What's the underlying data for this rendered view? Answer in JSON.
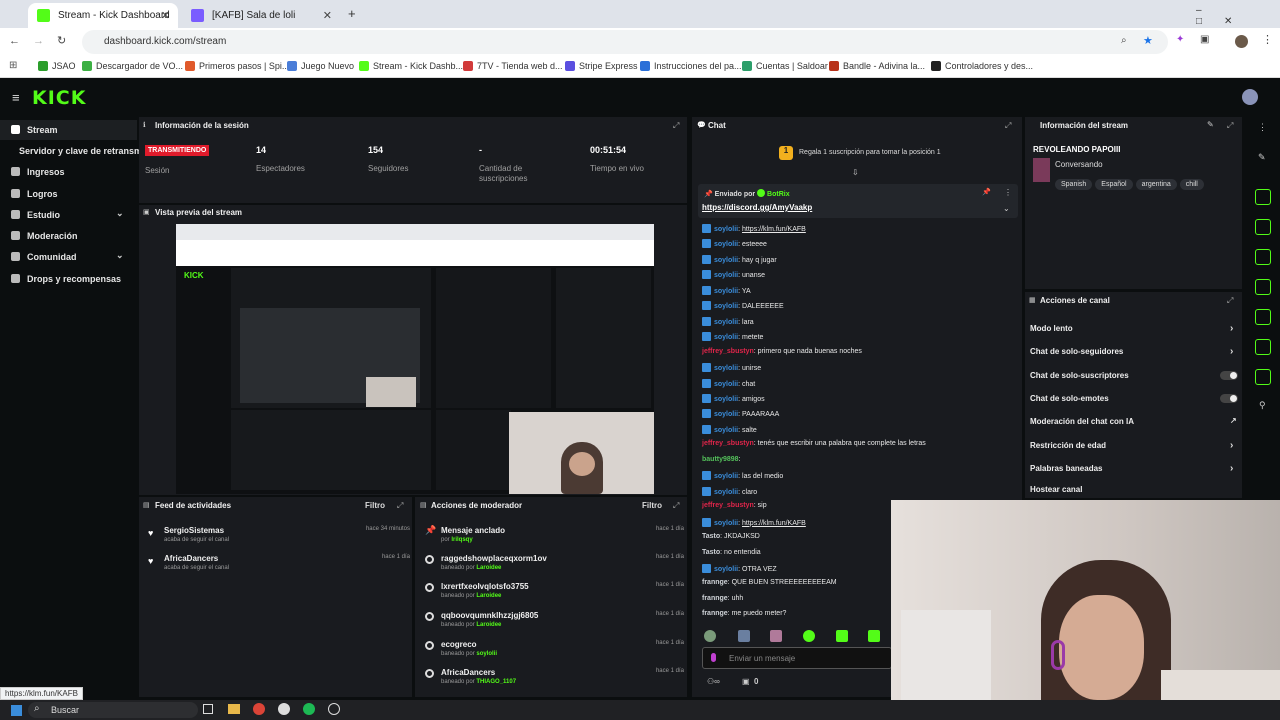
{
  "browser": {
    "tabs": [
      {
        "label": "Stream - Kick Dashboard",
        "active": true
      },
      {
        "label": "[KAFB] Sala de loli",
        "active": false
      }
    ],
    "address": "dashboard.kick.com/stream",
    "bookmarks": [
      "JSAO",
      "Descargador de VO...",
      "Primeros pasos | Spi...",
      "Juego Nuevo",
      "Stream - Kick Dashb...",
      "7TV - Tienda web d...",
      "Stripe Express",
      "Instrucciones del pa...",
      "Cuentas | Saldoar",
      "Bandle - Adivina la...",
      "Controladores y des..."
    ]
  },
  "sidebar": {
    "items": [
      {
        "label": "Stream"
      },
      {
        "label": "Servidor y clave de retransmisión"
      },
      {
        "label": "Ingresos"
      },
      {
        "label": "Logros"
      },
      {
        "label": "Estudio"
      },
      {
        "label": "Moderación"
      },
      {
        "label": "Comunidad"
      },
      {
        "label": "Drops y recompensas"
      }
    ]
  },
  "session": {
    "title": "Información de la sesión",
    "badge": "TRANSMITIENDO",
    "label": "Sesión",
    "stats": [
      {
        "value": "14",
        "label": "Espectadores"
      },
      {
        "value": "154",
        "label": "Seguidores"
      },
      {
        "value": "-",
        "label": "Cantidad de suscripciones"
      },
      {
        "value": "00:51:54",
        "label": "Tiempo en vivo"
      }
    ]
  },
  "preview": {
    "title": "Vista previa del stream"
  },
  "feed": {
    "title": "Feed de actividades",
    "filter": "Filtro",
    "items": [
      {
        "name": "SergioSistemas",
        "sub": "acaba de seguir el canal",
        "time": "hace 34 minutos"
      },
      {
        "name": "AfricaDancers",
        "sub": "acaba de seguir el canal",
        "time": "hace 1 día"
      }
    ]
  },
  "mod": {
    "title": "Acciones de moderador",
    "filter": "Filtro",
    "items": [
      {
        "name": "Mensaje anclado",
        "pre": "por",
        "by": "lrilqsqy",
        "time": "hace 1 día"
      },
      {
        "name": "raggedshowplaceqxorm1ov",
        "pre": "baneado por",
        "by": "Laroidee",
        "time": "hace 1 día"
      },
      {
        "name": "lxrertfxeolvqlotsfo3755",
        "pre": "baneado por",
        "by": "Laroidee",
        "time": "hace 1 día"
      },
      {
        "name": "qqboovqumnklhzzjgj6805",
        "pre": "baneado por",
        "by": "Laroidee",
        "time": "hace 1 día"
      },
      {
        "name": "ecogreco",
        "pre": "baneado por",
        "by": "soylolii",
        "time": "hace 1 día"
      },
      {
        "name": "AfricaDancers",
        "pre": "baneado por",
        "by": "THIAGO_1107",
        "time": "hace 1 día"
      }
    ]
  },
  "chat": {
    "title": "Chat",
    "promo": "Regala 1 suscripción para tomar la posición 1",
    "pinned_header": "Enviado por",
    "pinned_user": "BotRix",
    "pinned_link": "https://discord.gg/AmyVaakp",
    "messages": [
      {
        "user": "soylolii",
        "text": "https://klm.fun/KAFB",
        "link": true,
        "color": "#3a8ddb"
      },
      {
        "user": "soylolii",
        "text": "esteeee",
        "color": "#3a8ddb"
      },
      {
        "user": "soylolii",
        "text": "hay q jugar",
        "color": "#3a8ddb"
      },
      {
        "user": "soylolii",
        "text": "unanse",
        "color": "#3a8ddb"
      },
      {
        "user": "soylolii",
        "text": "YA",
        "color": "#3a8ddb"
      },
      {
        "user": "soylolii",
        "text": "DALEEEEEE",
        "color": "#3a8ddb"
      },
      {
        "user": "soylolii",
        "text": "lara",
        "color": "#3a8ddb"
      },
      {
        "user": "soylolii",
        "text": "metete",
        "color": "#3a8ddb"
      },
      {
        "user": "jeffrey_sbustyn",
        "text": "primero que nada buenas noches",
        "color": "#e0254a",
        "nobadge": true
      },
      {
        "user": "soylolii",
        "text": "unirse",
        "color": "#3a8ddb"
      },
      {
        "user": "soylolii",
        "text": "chat",
        "color": "#3a8ddb"
      },
      {
        "user": "soylolii",
        "text": "amigos",
        "color": "#3a8ddb"
      },
      {
        "user": "soylolii",
        "text": "PAAARAAA",
        "color": "#3a8ddb"
      },
      {
        "user": "soylolii",
        "text": "salte",
        "color": "#3a8ddb"
      },
      {
        "user": "jeffrey_sbustyn",
        "text": "tenés que escribir una palabra que complete las letras",
        "color": "#e0254a",
        "nobadge": true
      },
      {
        "user": "bautty9898",
        "text": "",
        "color": "#53c05a",
        "nobadge": true
      },
      {
        "user": "soylolii",
        "text": "las del medio",
        "color": "#3a8ddb"
      },
      {
        "user": "soylolii",
        "text": "claro",
        "color": "#3a8ddb"
      },
      {
        "user": "jeffrey_sbustyn",
        "text": "sip",
        "color": "#e0254a",
        "nobadge": true
      },
      {
        "user": "soylolii",
        "text": "https://klm.fun/KAFB",
        "link": true,
        "color": "#3a8ddb"
      },
      {
        "user": "Tasto",
        "text": "JKDAJKSD",
        "color": "#cfd3d8",
        "nobadge": true
      },
      {
        "user": "Tasto",
        "text": "no entendia",
        "color": "#cfd3d8",
        "nobadge": true
      },
      {
        "user": "soylolii",
        "text": "OTRA VEZ",
        "color": "#3a8ddb"
      },
      {
        "user": "frannge",
        "text": "QUE BUEN STREEEEEEEEEAM",
        "color": "#cfd3d8",
        "nobadge": true
      },
      {
        "user": "frannge",
        "text": "uhh",
        "color": "#cfd3d8",
        "nobadge": true
      },
      {
        "user": "frannge",
        "text": "me puedo meter?",
        "color": "#cfd3d8",
        "nobadge": true
      }
    ],
    "input_placeholder": "Enviar un mensaje",
    "footer_count": "0"
  },
  "stream_info": {
    "title": "Información del stream",
    "stream_title": "REVOLEANDO PAPOIII",
    "category": "Conversando",
    "tags": [
      "Spanish",
      "Español",
      "argentina",
      "chill"
    ]
  },
  "channel_actions": {
    "title": "Acciones de canal",
    "items": [
      {
        "label": "Modo lento",
        "kind": "arrow"
      },
      {
        "label": "Chat de solo-seguidores",
        "kind": "arrow"
      },
      {
        "label": "Chat de solo-suscriptores",
        "kind": "toggle"
      },
      {
        "label": "Chat de solo-emotes",
        "kind": "toggle"
      },
      {
        "label": "Moderación del chat con IA",
        "kind": "ext"
      },
      {
        "label": "Restricción de edad",
        "kind": "arrow"
      },
      {
        "label": "Palabras baneadas",
        "kind": "arrow"
      },
      {
        "label": "Hostear canal",
        "kind": "none"
      }
    ]
  },
  "status_bar": "https://klm.fun/KAFB",
  "taskbar": {
    "search": "Buscar"
  },
  "colors": {
    "accent": "#53fc18",
    "live": "#e01b2b",
    "panel": "#191b1f"
  }
}
